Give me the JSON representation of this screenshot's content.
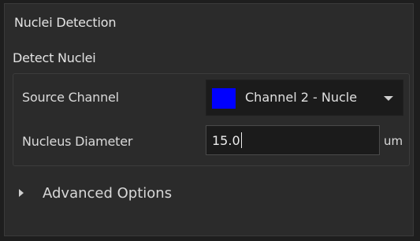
{
  "panel": {
    "title": "Nuclei Detection",
    "group_title": "Detect Nuclei"
  },
  "source_channel": {
    "label": "Source Channel",
    "selected": "Channel 2 - Nucle",
    "swatch_color": "#0000ff",
    "icon": "chevron-down-icon"
  },
  "nucleus_diameter": {
    "label": "Nucleus Diameter",
    "value": "15.0",
    "unit": "um"
  },
  "advanced": {
    "label": "Advanced Options",
    "icon": "triangle-right-icon"
  }
}
